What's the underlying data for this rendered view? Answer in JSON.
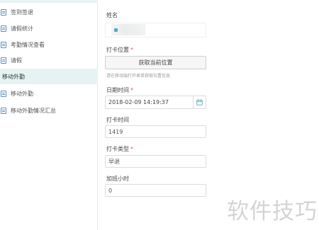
{
  "sidebar": {
    "items": [
      {
        "label": "签到签退"
      },
      {
        "label": "请假统计"
      },
      {
        "label": "考勤情况查看"
      },
      {
        "label": "请假"
      }
    ],
    "group_label": "移动外勤",
    "group_items": [
      {
        "label": "移动外勤"
      },
      {
        "label": "移动外勤情况汇总"
      }
    ]
  },
  "form": {
    "name_label": "姓名",
    "location_label": "打卡位置",
    "location_button": "获取当前位置",
    "location_hint": "请在移动端打开表单获取位置信息",
    "datetime_label": "日期时间",
    "datetime_value": "2018-02-09 14:19:37",
    "punch_time_label": "打卡时间",
    "punch_time_value": "1419",
    "punch_type_label": "打卡类型",
    "punch_type_value": "早退",
    "overtime_label": "加班小时",
    "overtime_value": "0",
    "required_mark": "*"
  },
  "watermark": "软件技巧",
  "colors": {
    "accent": "#5b8ec2",
    "active_group_bg": "#e6f3f3",
    "required": "#e05a4e"
  }
}
